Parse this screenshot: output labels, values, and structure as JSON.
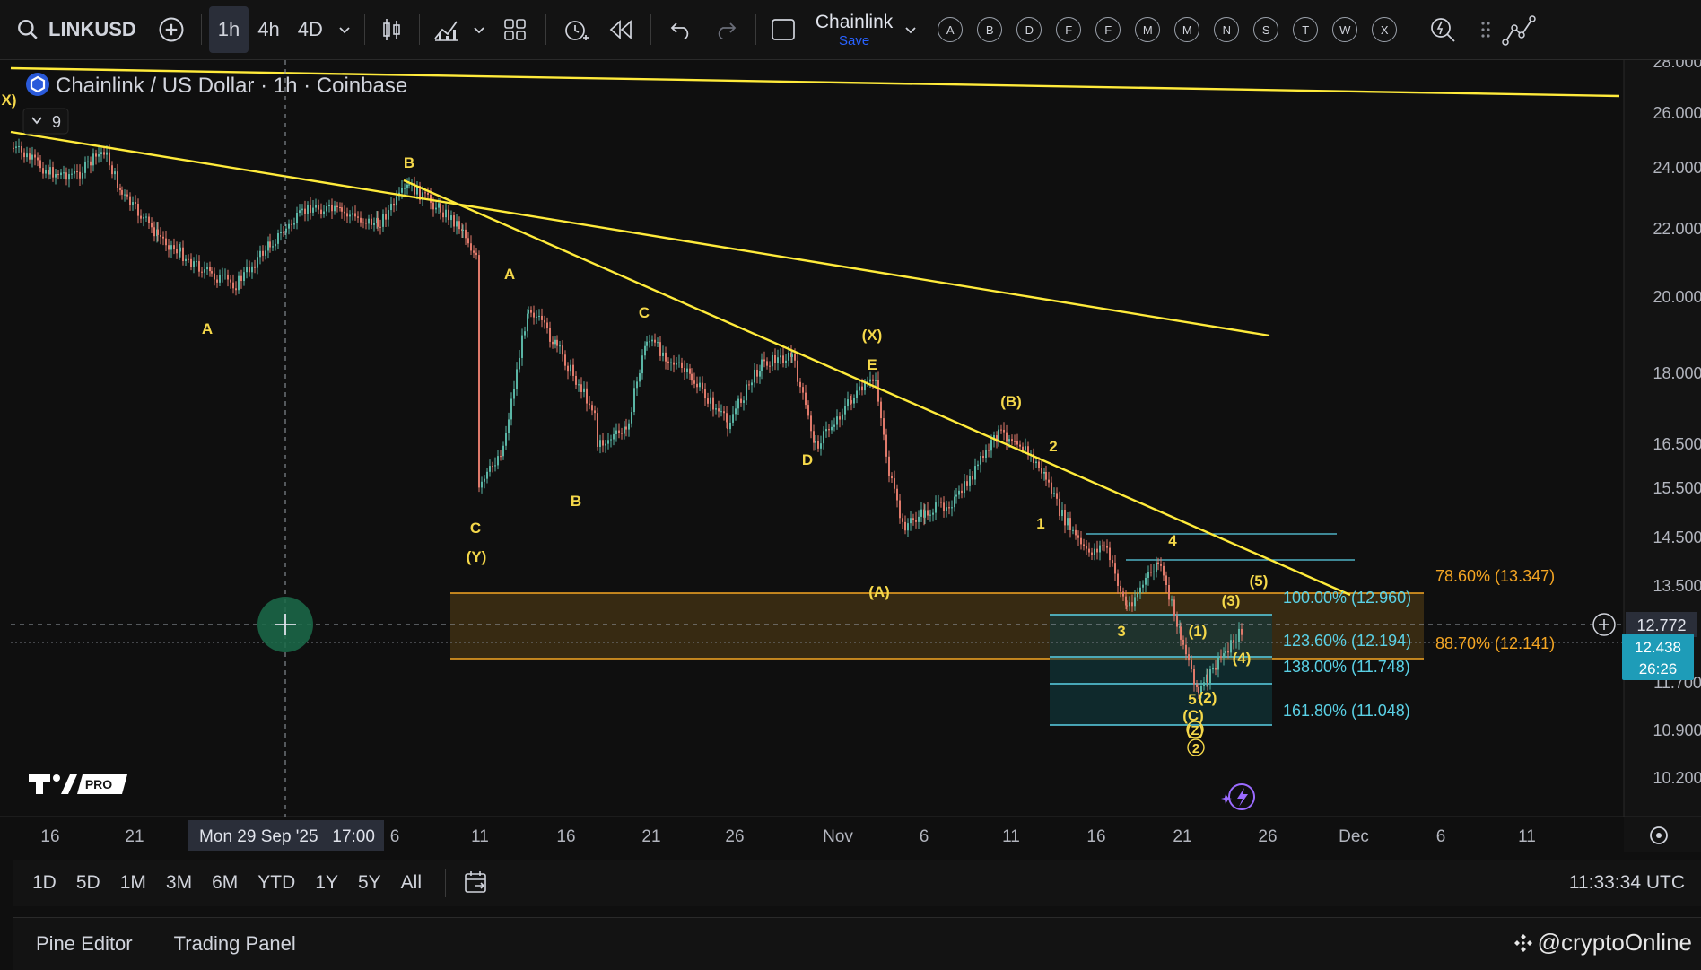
{
  "toolbar": {
    "symbol": "LINKUSD",
    "timeframes": [
      "1h",
      "4h",
      "4D"
    ],
    "active_timeframe": "1h",
    "layout_name": "Chainlink",
    "layout_save": "Save",
    "letter_buttons": [
      "A",
      "B",
      "D",
      "F",
      "F",
      "M",
      "M",
      "N",
      "S",
      "T",
      "W",
      "X"
    ]
  },
  "legend": {
    "title": "Chainlink / US Dollar · 1h · Coinbase",
    "indicator_count": "9"
  },
  "price_axis": {
    "ticks": [
      "28.000",
      "26.000",
      "24.000",
      "22.000",
      "20.000",
      "18.000",
      "16.500",
      "15.500",
      "14.500",
      "13.500",
      "11.700",
      "10.900",
      "10.200"
    ],
    "crosshair_price": "12.772",
    "last_price": "12.438",
    "countdown": "26:26"
  },
  "time_axis": {
    "ticks": [
      "16",
      "21",
      "6",
      "11",
      "16",
      "21",
      "26",
      "Nov",
      "6",
      "11",
      "16",
      "21",
      "26",
      "Dec",
      "6",
      "11"
    ],
    "crosshair_label": "Mon 29 Sep '25   17:00"
  },
  "fib_levels": [
    {
      "label": "78.60% (13.347)",
      "color": "#f5a623"
    },
    {
      "label": "100.00% (12.960)",
      "color": "#5ad1e6"
    },
    {
      "label": "123.60% (12.194)",
      "color": "#5ad1e6"
    },
    {
      "label": "88.70% (12.141)",
      "color": "#f5a623"
    },
    {
      "label": "138.00% (11.748)",
      "color": "#5ad1e6"
    },
    {
      "label": "161.80% (11.048)",
      "color": "#5ad1e6"
    }
  ],
  "wave_labels": [
    "X)",
    "B",
    "A",
    "A",
    "C",
    "B",
    "C",
    "(Y)",
    "(X)",
    "E",
    "D",
    "(A)",
    "(B)",
    "2",
    "1",
    "3",
    "4",
    "(5)",
    "(3)",
    "(1)",
    "(4)",
    "5",
    "(2)",
    "(C)",
    "(Z)",
    "2"
  ],
  "ranges": [
    "1D",
    "5D",
    "1M",
    "3M",
    "6M",
    "YTD",
    "1Y",
    "5Y",
    "All"
  ],
  "clock": "11:33:34 UTC",
  "panels": [
    "Pine Editor",
    "Trading Panel"
  ],
  "watermark": "@cryptoOnline",
  "logo_badge": "PRO",
  "colors": {
    "background": "#0f0f0f",
    "trendline": "#ffeb3b",
    "label": "#f5d84a",
    "fib_orange": "#f5a623",
    "fib_cyan": "#5ad1e6",
    "price_badge": "#1e9cb8",
    "up_candle": "#5ab5a5",
    "down_candle": "#e07a6b"
  }
}
